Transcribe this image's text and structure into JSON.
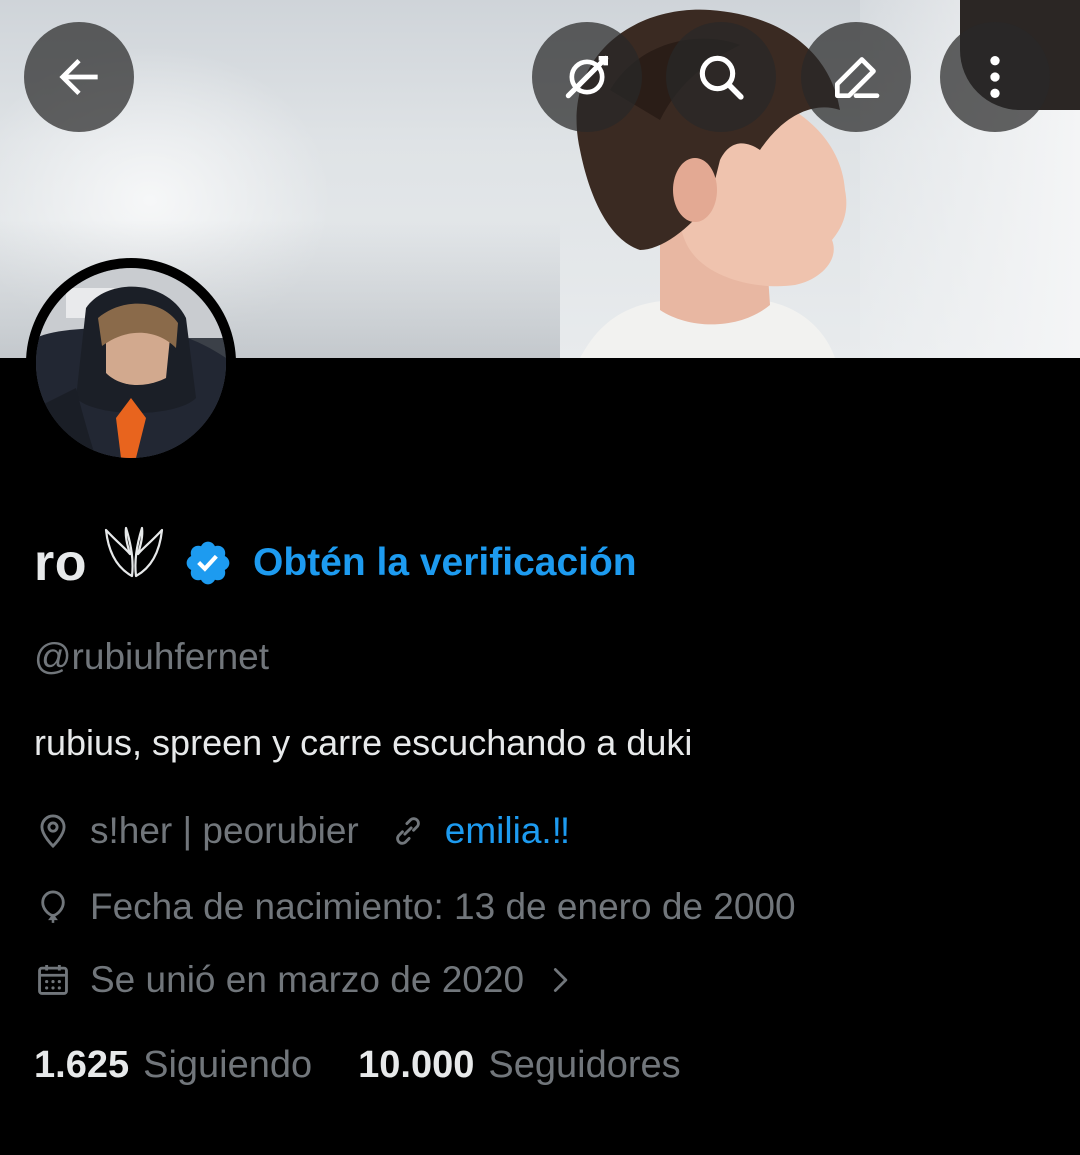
{
  "profile": {
    "display_name": "ro",
    "verify_cta": "Obtén la verificación",
    "handle": "@rubiuhfernet",
    "bio": "rubius, spreen y carre escuchando a duki",
    "location": "s!her | peorubier",
    "website": "emilia.‼",
    "birthday": "Fecha de nacimiento: 13 de enero de 2000",
    "joined": "Se unió en marzo de 2020"
  },
  "stats": {
    "following_count": "1.625",
    "following_label": "Siguiendo",
    "followers_count": "10.000",
    "followers_label": "Seguidores"
  },
  "icons": {
    "back": "arrow-left-icon",
    "grok": "grok-icon",
    "search": "search-icon",
    "edit": "edit-pencil-icon",
    "more": "more-vertical-icon",
    "location": "location-pin-icon",
    "link": "link-icon",
    "birthday": "balloon-icon",
    "joined": "calendar-icon",
    "chevron": "chevron-right-icon",
    "verified": "verified-badge-icon",
    "emoji": "wings-emoji-icon"
  },
  "colors": {
    "background": "#000000",
    "accent": "#1d9bf0",
    "primary_text": "#e7e9ea",
    "secondary_text": "#71767b"
  }
}
